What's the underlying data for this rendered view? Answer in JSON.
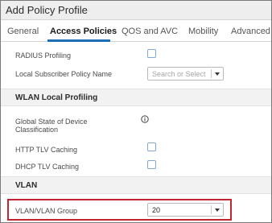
{
  "dialog": {
    "title": "Add Policy Profile"
  },
  "tabs": [
    {
      "label": "General",
      "active": false
    },
    {
      "label": "Access Policies",
      "active": true
    },
    {
      "label": "QOS and AVC",
      "active": false
    },
    {
      "label": "Mobility",
      "active": false
    },
    {
      "label": "Advanced",
      "active": false
    }
  ],
  "fields": {
    "radius_profiling": {
      "label": "RADIUS Profiling",
      "checked": false
    },
    "local_subscriber_policy": {
      "label": "Local Subscriber Policy Name",
      "placeholder": "Search or Select"
    },
    "wlan_local_profiling": {
      "title": "WLAN Local Profiling"
    },
    "global_state": {
      "label_line1": "Global State of Device",
      "label_line2": "Classification",
      "icon": "info-icon"
    },
    "http_tlv": {
      "label": "HTTP TLV Caching",
      "checked": false
    },
    "dhcp_tlv": {
      "label": "DHCP TLV Caching",
      "checked": false
    },
    "vlan_section": {
      "title": "VLAN"
    },
    "vlan_group": {
      "label": "VLAN/VLAN Group",
      "value": "20"
    }
  },
  "colors": {
    "accent": "#1e6fb8",
    "highlight": "#c0262d",
    "checkbox_border": "#7fa9d6"
  }
}
